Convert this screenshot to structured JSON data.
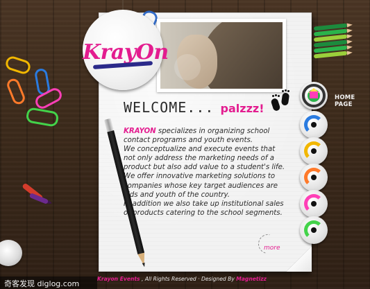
{
  "brand": {
    "logo_text": "KrayOn",
    "accent_pink": "#e31c8f",
    "logo_swoosh_color": "#2b2a8a"
  },
  "welcome": {
    "heading": "WELCOME...",
    "suffix": "palzzz!"
  },
  "intro": {
    "brand_word": "KRAYON",
    "line1_rest": "specializes in organizing school",
    "line2": "contact programs and youth events.",
    "line3": "We conceptualize and execute events that",
    "line4": "not only address the marketing needs of a",
    "line5": "product but also add value to a student's life.",
    "line6": "We offer innovative marketing solutions to",
    "line7": "companies whose key target audiences are",
    "line8": "kids and youth of the country.",
    "line9": "In addition we also take up institutional sales",
    "line10": "of products catering to the school segments."
  },
  "actions": {
    "more_label": "more"
  },
  "navigation": {
    "home_label": "HOME PAGE",
    "items": [
      {
        "name": "nav-dot-1",
        "color": "#2a7be0"
      },
      {
        "name": "nav-dot-2",
        "color": "#f2b700"
      },
      {
        "name": "nav-dot-3",
        "color": "#ff7a2a"
      },
      {
        "name": "nav-dot-4",
        "color": "#ff3fb7"
      },
      {
        "name": "nav-dot-5",
        "color": "#43d34a"
      }
    ]
  },
  "footer": {
    "left": "Krayon Events",
    "mid": ", All Rights Reserved",
    "designed_by_label": "Designed By",
    "designer": "Magnetizz"
  },
  "watermark": {
    "text": "奇客发现 diglog.com"
  }
}
